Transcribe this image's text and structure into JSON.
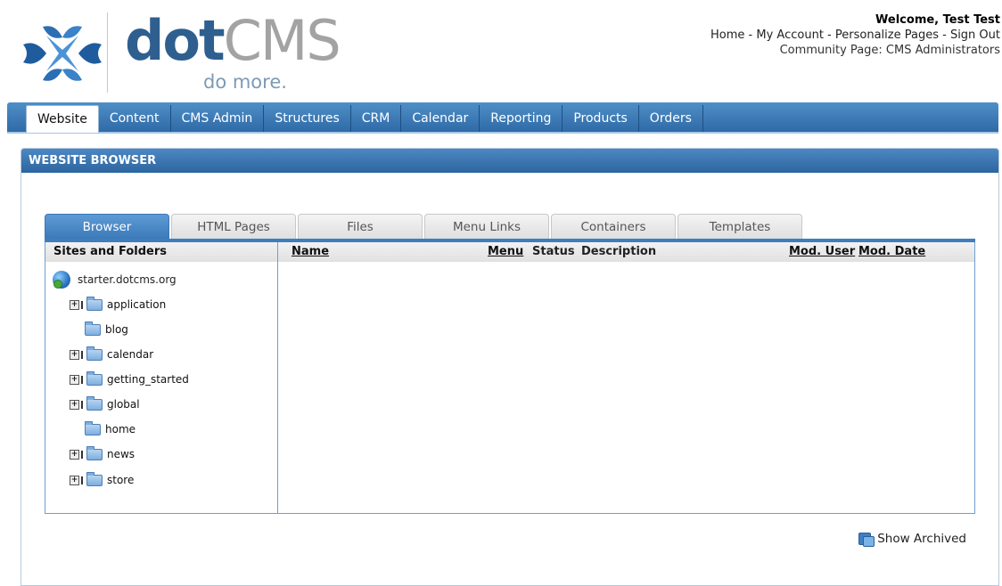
{
  "brand": {
    "dot": "dot",
    "cms": "CMS",
    "tagline": "do more."
  },
  "user": {
    "welcome": "Welcome, Test Test",
    "links": [
      "Home",
      "My Account",
      "Personalize Pages",
      "Sign Out"
    ],
    "separator": " - ",
    "community": "Community Page: CMS Administrators"
  },
  "nav": {
    "tabs": [
      "Website",
      "Content",
      "CMS Admin",
      "Structures",
      "CRM",
      "Calendar",
      "Reporting",
      "Products",
      "Orders"
    ],
    "active": "Website"
  },
  "panel": {
    "title": "WEBSITE BROWSER"
  },
  "subtabs": {
    "items": [
      "Browser",
      "HTML Pages",
      "Files",
      "Menu Links",
      "Containers",
      "Templates"
    ],
    "active": "Browser"
  },
  "tree": {
    "header": "Sites and Folders",
    "site": "starter.dotcms.org",
    "folders": [
      {
        "name": "application",
        "expandable": true
      },
      {
        "name": "blog",
        "expandable": false
      },
      {
        "name": "calendar",
        "expandable": true
      },
      {
        "name": "getting_started",
        "expandable": true
      },
      {
        "name": "global",
        "expandable": true
      },
      {
        "name": "home",
        "expandable": false
      },
      {
        "name": "news",
        "expandable": true
      },
      {
        "name": "store",
        "expandable": true
      }
    ]
  },
  "grid": {
    "columns": {
      "name": "Name",
      "menu": "Menu",
      "status": "Status",
      "description": "Description",
      "mod_user": "Mod. User",
      "mod_date": "Mod. Date"
    }
  },
  "show_archived": "Show Archived",
  "colors": {
    "nav": "#3a76b3",
    "accent": "#2e5f8f"
  }
}
